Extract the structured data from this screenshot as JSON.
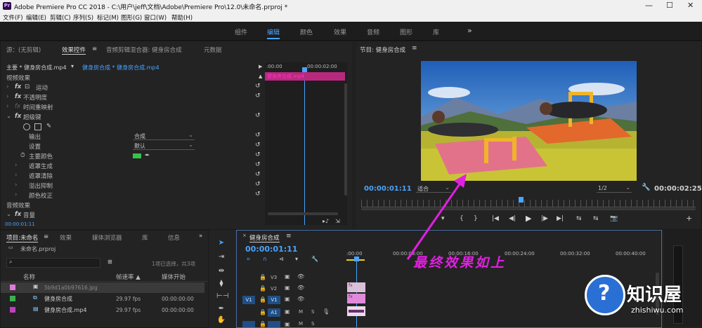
{
  "window": {
    "app_icon": "Pr",
    "title": "Adobe Premiere Pro CC 2018 - C:\\用户\\jeff\\文档\\Adobe\\Premiere Pro\\12.0\\未命名.prproj *",
    "minimize": "—",
    "maximize": "☐",
    "close": "✕"
  },
  "menu": [
    "文件(F)",
    "编辑(E)",
    "剪辑(C)",
    "序列(S)",
    "标记(M)",
    "图形(G)",
    "窗口(W)",
    "帮助(H)"
  ],
  "workspaces": {
    "items": [
      "组件",
      "编辑",
      "颜色",
      "效果",
      "音频",
      "图形",
      "库"
    ],
    "active": "编辑",
    "more": "»"
  },
  "effect_controls": {
    "tabs": [
      "源：(无剪辑)",
      "效果控件",
      "≡",
      "音频剪辑混合器: 健身房合成",
      "元数据"
    ],
    "master_label": "主要 * 健身房合成.mp4",
    "clip_label": "健身房合成 * 健身房合成.mp4",
    "play_arrow": "▶",
    "ruler_start": ":00:00",
    "ruler_end": "00:00:02:00",
    "mini_clip": "健身房合成.mp4",
    "video_header": "视频效果",
    "rows": [
      {
        "fx": "fx",
        "label": "运动",
        "icon": "⊡"
      },
      {
        "fx": "fx",
        "label": "不透明度"
      },
      {
        "fx": "fx",
        "label": "时间重映射"
      },
      {
        "fx": "fx",
        "label": "超级键"
      }
    ],
    "output_label": "输出",
    "output_value": "合成",
    "settings_label": "设置",
    "settings_value": "默认",
    "key_color_label": "主要颜色",
    "key_color": "#36c24a",
    "sub_rows": [
      "遮罩生成",
      "遮罩清除",
      "溢出抑制",
      "颜色校正"
    ],
    "audio_header": "音频效果",
    "audio_row": "音量",
    "timecode": "00:00:01:11"
  },
  "program": {
    "title": "节目: 健身房合成",
    "menu": "≡",
    "timecode": "00:00:01:11",
    "fit": "适合",
    "quality": "1/2",
    "duration": "00:00:02:25",
    "controls": [
      "▾",
      "{",
      "}",
      "|◀",
      "◀|",
      "▶",
      "|▶",
      "▶|",
      "⇆",
      "⇆",
      "📷",
      "+"
    ]
  },
  "project": {
    "tabs": [
      "项目:未命名",
      "≡",
      "效果",
      "媒体浏览器",
      "库",
      "信息"
    ],
    "filename": "未命名.prproj",
    "selection": "1项已选择，共3项",
    "columns": [
      "名称",
      "帧速率 ▲",
      "媒体开始"
    ],
    "items": [
      {
        "name": "5b9d1a0b97616.jpg",
        "fps": "",
        "start": "",
        "color": "#e07ad9"
      },
      {
        "name": "健身房合成",
        "fps": "29.97 fps",
        "start": "00:00:00:00",
        "color": "#3cb04b"
      },
      {
        "name": "健身房合成.mp4",
        "fps": "29.97 fps",
        "start": "00:00:00:00",
        "color": "#c040c0"
      }
    ]
  },
  "timeline": {
    "title": "健身房合成",
    "menu": "≡",
    "close": "×",
    "timecode": "00:00:01:11",
    "ruler": [
      ":00:00",
      "00:00:08:00",
      "00:00:16:00",
      "00:00:24:00",
      "00:00:32:00",
      "00:00:40:00"
    ],
    "tracks": [
      "V3",
      "V2",
      "V1",
      "A1",
      "A2"
    ],
    "source_patch": "V1",
    "source_patch_audio": "A1"
  },
  "annotation": {
    "text": "最终效果如上",
    "color": "#e020e0"
  },
  "watermark": {
    "brand": "知识屋",
    "url": "zhishiwu.com"
  }
}
